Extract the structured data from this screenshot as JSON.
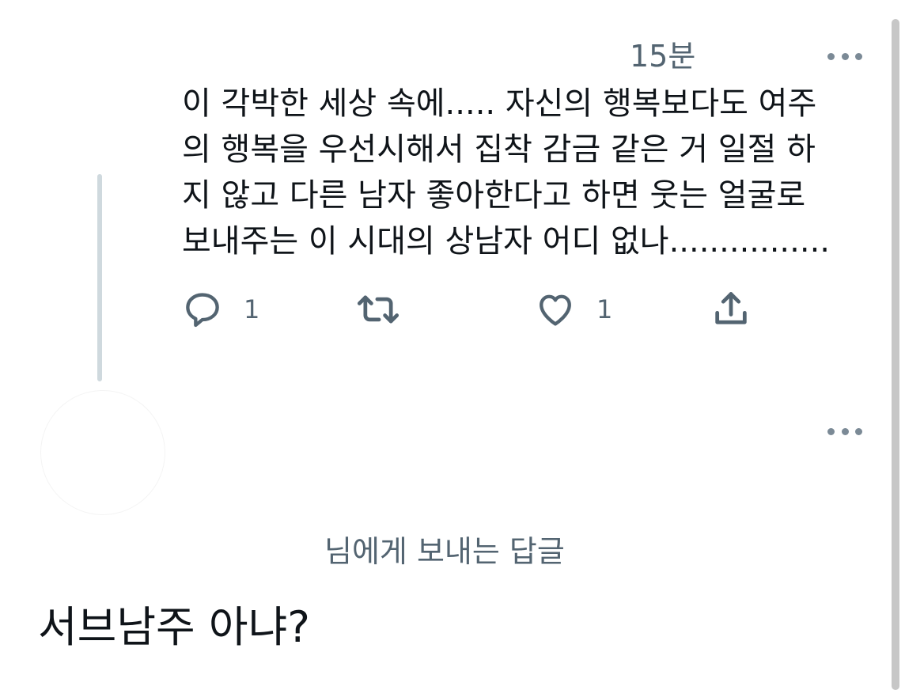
{
  "tweet": {
    "timestamp": "15분",
    "lines": [
      "이 각박한 세상 속에..... 자신의 행복보다도 여주",
      "의 행복을 우선시해서 집착 감금 같은 거 일절 하",
      "지 않고 다른 남자 좋아한다고 하면 웃는 얼굴로",
      "보내주는 이 시대의 상남자 어디 없나................"
    ],
    "actions": {
      "reply_count": "1",
      "like_count": "1"
    }
  },
  "reply": {
    "replying_to": "님에게 보내는 답글",
    "compose_text": "서브남주 아냐?"
  },
  "icons": {
    "more": "more-horizontal-icon",
    "reply": "speech-bubble-icon",
    "retweet": "retweet-icon",
    "like": "heart-icon",
    "share": "share-upload-icon"
  },
  "colors": {
    "text": "#0f1419",
    "secondary": "#536471",
    "thread_line": "#cfd9de"
  }
}
